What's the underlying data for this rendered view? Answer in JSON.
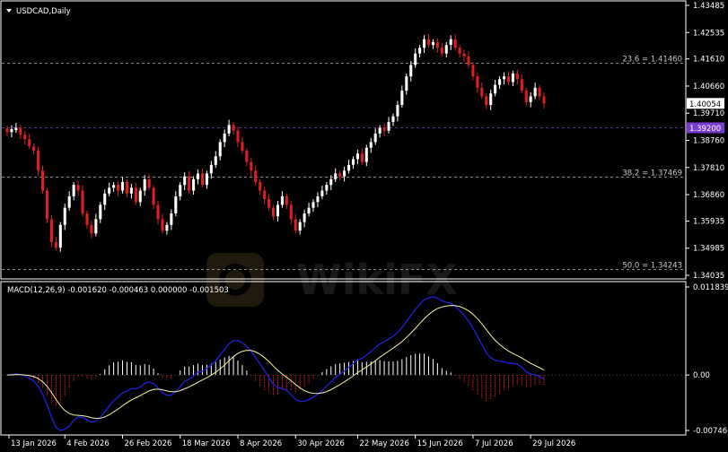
{
  "chart_data": [
    {
      "type": "candlestick",
      "title": "USDCAD,Daily",
      "ylim": [
        1.34035,
        1.43485
      ],
      "y_ticks": [
        "1.43485",
        "1.42535",
        "1.41610",
        "1.40660",
        "1.39710",
        "1.38760",
        "1.37810",
        "1.36860",
        "1.35935",
        "1.34985",
        "1.34035"
      ],
      "x_ticks": [
        "13 Jan 2026",
        "4 Feb 2026",
        "26 Feb 2026",
        "18 Mar 2026",
        "8 Apr 2026",
        "30 Apr 2026",
        "22 May 2026",
        "15 Jun 2026",
        "7 Jul 2026",
        "29 Jul 2026"
      ],
      "current_price": "1.40054",
      "marker_price": "1.39200",
      "fib_levels": [
        {
          "label": "23.6 = 1.41460",
          "value": 1.4146
        },
        {
          "label": "38.2 = 1.37469",
          "value": 1.37469
        },
        {
          "label": "50.0 = 1.34243",
          "value": 1.34243
        }
      ],
      "close": [
        1.3905,
        1.3915,
        1.392,
        1.3895,
        1.388,
        1.3855,
        1.384,
        1.377,
        1.37,
        1.36,
        1.352,
        1.35,
        1.358,
        1.364,
        1.368,
        1.372,
        1.37,
        1.362,
        1.358,
        1.355,
        1.36,
        1.365,
        1.369,
        1.371,
        1.372,
        1.37,
        1.373,
        1.369,
        1.371,
        1.366,
        1.37,
        1.374,
        1.371,
        1.365,
        1.36,
        1.356,
        1.358,
        1.362,
        1.368,
        1.372,
        1.375,
        1.37,
        1.374,
        1.376,
        1.372,
        1.376,
        1.379,
        1.382,
        1.387,
        1.39,
        1.393,
        1.391,
        1.387,
        1.384,
        1.38,
        1.377,
        1.373,
        1.37,
        1.367,
        1.364,
        1.361,
        1.365,
        1.368,
        1.365,
        1.36,
        1.356,
        1.359,
        1.362,
        1.364,
        1.366,
        1.368,
        1.37,
        1.372,
        1.374,
        1.376,
        1.375,
        1.377,
        1.379,
        1.381,
        1.383,
        1.38,
        1.385,
        1.387,
        1.39,
        1.392,
        1.391,
        1.394,
        1.396,
        1.4,
        1.405,
        1.41,
        1.414,
        1.418,
        1.42,
        1.423,
        1.421,
        1.422,
        1.42,
        1.418,
        1.421,
        1.423,
        1.42,
        1.418,
        1.417,
        1.414,
        1.41,
        1.406,
        1.403,
        1.4,
        1.404,
        1.407,
        1.409,
        1.41,
        1.408,
        1.411,
        1.409,
        1.405,
        1.401,
        1.403,
        1.406,
        1.403,
        1.4005
      ]
    },
    {
      "type": "macd",
      "title": "MACD(12,26,9) -0.001620 -0.000463 0.000000 -0.001503",
      "ylim": [
        -0.007466,
        0.011839
      ],
      "y_ticks": [
        "0.011839",
        "0.00",
        "-0.007466"
      ]
    }
  ]
}
